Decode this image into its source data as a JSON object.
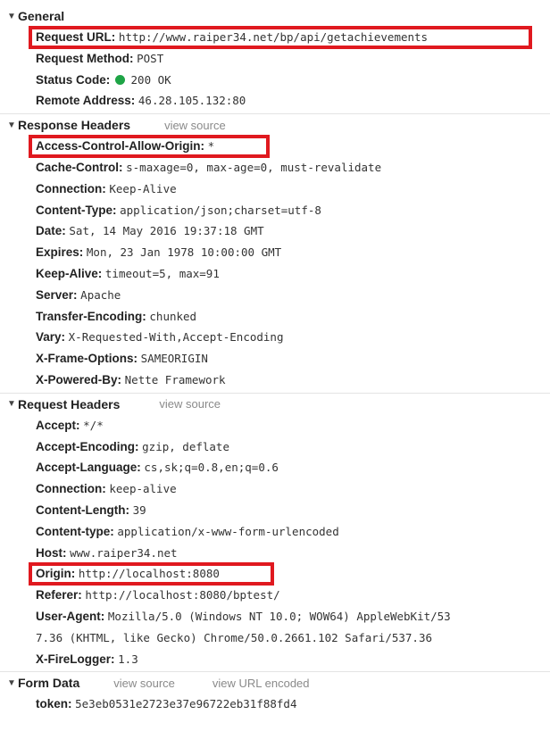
{
  "general": {
    "title": "General",
    "request_url_key": "Request URL:",
    "request_url_val": "http://www.raiper34.net/bp/api/getachievements",
    "method_key": "Request Method:",
    "method_val": "POST",
    "status_key": "Status Code:",
    "status_val": "200 OK",
    "remote_key": "Remote Address:",
    "remote_val": "46.28.105.132:80"
  },
  "response_headers": {
    "title": "Response Headers",
    "view_source": "view source",
    "items": [
      {
        "k": "Access-Control-Allow-Origin:",
        "v": "*"
      },
      {
        "k": "Cache-Control:",
        "v": "s-maxage=0, max-age=0, must-revalidate"
      },
      {
        "k": "Connection:",
        "v": "Keep-Alive"
      },
      {
        "k": "Content-Type:",
        "v": "application/json;charset=utf-8"
      },
      {
        "k": "Date:",
        "v": "Sat, 14 May 2016 19:37:18 GMT"
      },
      {
        "k": "Expires:",
        "v": "Mon, 23 Jan 1978 10:00:00 GMT"
      },
      {
        "k": "Keep-Alive:",
        "v": "timeout=5, max=91"
      },
      {
        "k": "Server:",
        "v": "Apache"
      },
      {
        "k": "Transfer-Encoding:",
        "v": "chunked"
      },
      {
        "k": "Vary:",
        "v": "X-Requested-With,Accept-Encoding"
      },
      {
        "k": "X-Frame-Options:",
        "v": "SAMEORIGIN"
      },
      {
        "k": "X-Powered-By:",
        "v": "Nette Framework"
      }
    ]
  },
  "request_headers": {
    "title": "Request Headers",
    "view_source": "view source",
    "items": [
      {
        "k": "Accept:",
        "v": "*/*"
      },
      {
        "k": "Accept-Encoding:",
        "v": "gzip, deflate"
      },
      {
        "k": "Accept-Language:",
        "v": "cs,sk;q=0.8,en;q=0.6"
      },
      {
        "k": "Connection:",
        "v": "keep-alive"
      },
      {
        "k": "Content-Length:",
        "v": "39"
      },
      {
        "k": "Content-type:",
        "v": "application/x-www-form-urlencoded"
      },
      {
        "k": "Host:",
        "v": "www.raiper34.net"
      },
      {
        "k": "Origin:",
        "v": "http://localhost:8080"
      },
      {
        "k": "Referer:",
        "v": "http://localhost:8080/bptest/"
      },
      {
        "k": "User-Agent:",
        "v": "Mozilla/5.0 (Windows NT 10.0; WOW64) AppleWebKit/53"
      },
      {
        "k": "",
        "v": "7.36 (KHTML, like Gecko) Chrome/50.0.2661.102 Safari/537.36"
      },
      {
        "k": "X-FireLogger:",
        "v": "1.3"
      }
    ]
  },
  "form_data": {
    "title": "Form Data",
    "view_source": "view source",
    "view_url_encoded": "view URL encoded",
    "token_key": "token:",
    "token_val": "5e3eb0531e2723e37e96722eb31f88fd4"
  },
  "colors": {
    "highlight": "#e0191f",
    "status_ok": "#1ea446"
  }
}
